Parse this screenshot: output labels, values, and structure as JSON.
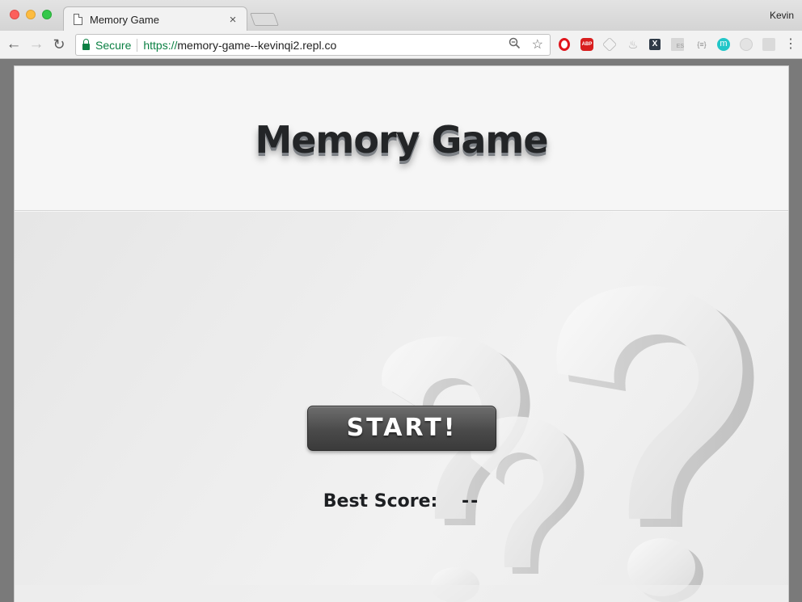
{
  "browser": {
    "tab_title": "Memory Game",
    "tab_close": "×",
    "profile_name": "Kevin",
    "secure_label": "Secure",
    "url_scheme": "https://",
    "url_host": "memory-game--kevinqi2.repl.co",
    "nav": {
      "back": "←",
      "forward": "→",
      "reload": "↻"
    },
    "extensions": {
      "abp": "ABP",
      "x": "X",
      "es": "ES",
      "json": "{≡}",
      "m": "m"
    },
    "menu": "⋮"
  },
  "page": {
    "title": "Memory Game",
    "start_button": "START!",
    "best_score_label": "Best Score:",
    "best_score_value": "--"
  },
  "colors": {
    "secure_green": "#0b8043",
    "title_text": "#232527",
    "button_dark": "#4a4a4a"
  }
}
